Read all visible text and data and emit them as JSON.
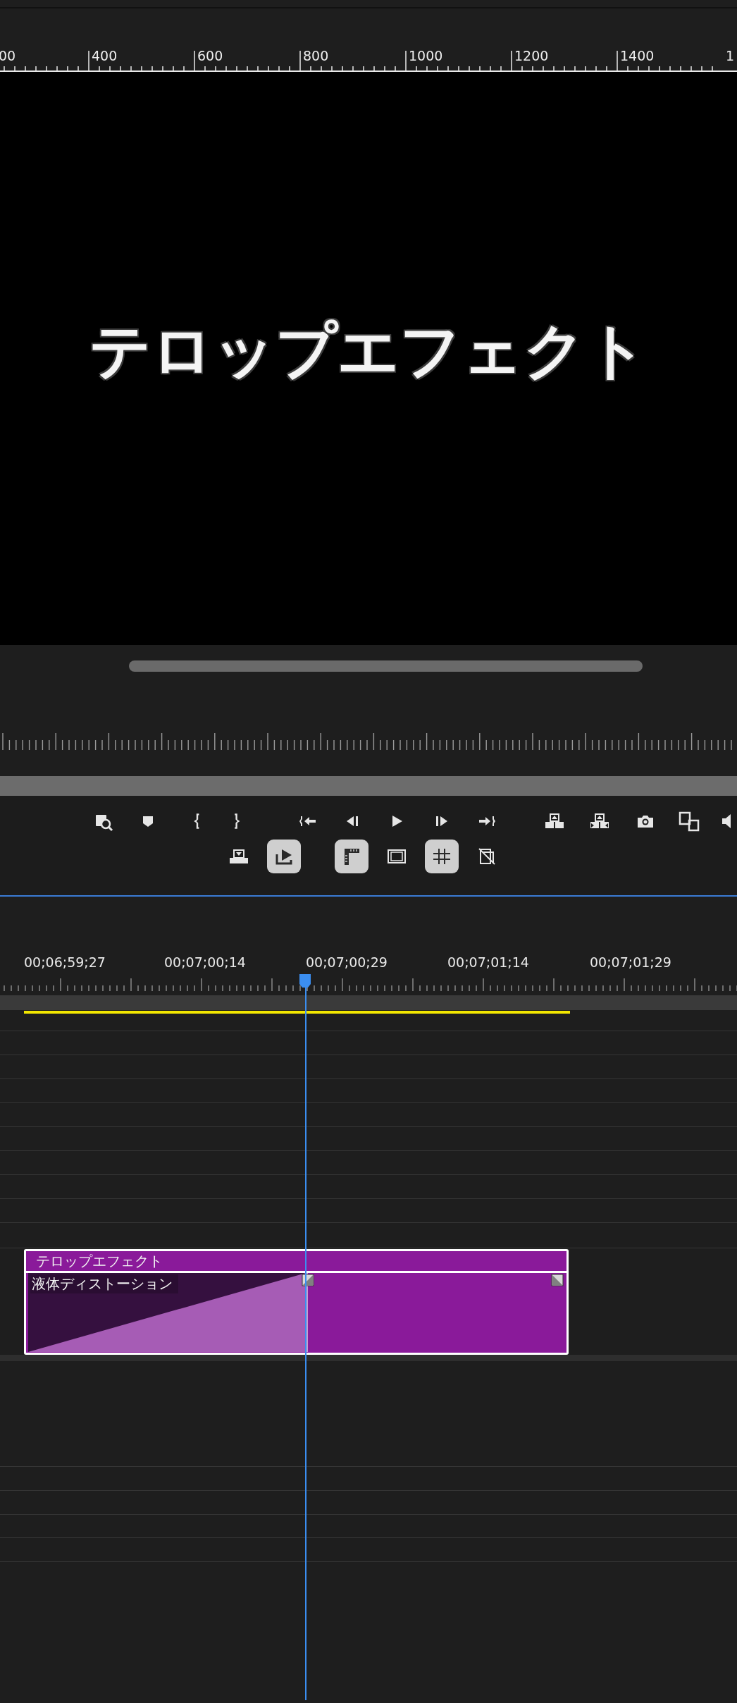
{
  "monitor_ruler": {
    "labels": [
      "00",
      "400",
      "600",
      "800",
      "1000",
      "1200",
      "1400",
      "1"
    ]
  },
  "preview": {
    "title_text": "テロップエフェクト"
  },
  "transport_row_1": [
    {
      "kind": "zoom"
    },
    {
      "kind": "marker"
    },
    {
      "kind": "mark-in"
    },
    {
      "kind": "mark-out"
    },
    {
      "kind": "go-in"
    },
    {
      "kind": "step-back"
    },
    {
      "kind": "play"
    },
    {
      "kind": "step-forward"
    },
    {
      "kind": "go-out"
    },
    {
      "kind": "lift"
    },
    {
      "kind": "extract"
    },
    {
      "kind": "camera"
    },
    {
      "kind": "compare"
    },
    {
      "kind": "speaker"
    }
  ],
  "transport_row_2": [
    {
      "kind": "insert",
      "on": false
    },
    {
      "kind": "export",
      "on": true
    },
    {
      "kind": "ruler",
      "on": true
    },
    {
      "kind": "margins",
      "on": false
    },
    {
      "kind": "grid",
      "on": true
    },
    {
      "kind": "snap",
      "on": false
    }
  ],
  "timeline": {
    "timecodes": [
      "00;06;59;27",
      "00;07;00;14",
      "00;07;00;29",
      "00;07;01;14",
      "00;07;01;29"
    ],
    "clip": {
      "title": "テロップエフェクト",
      "effect": "液体ディストーション"
    }
  }
}
